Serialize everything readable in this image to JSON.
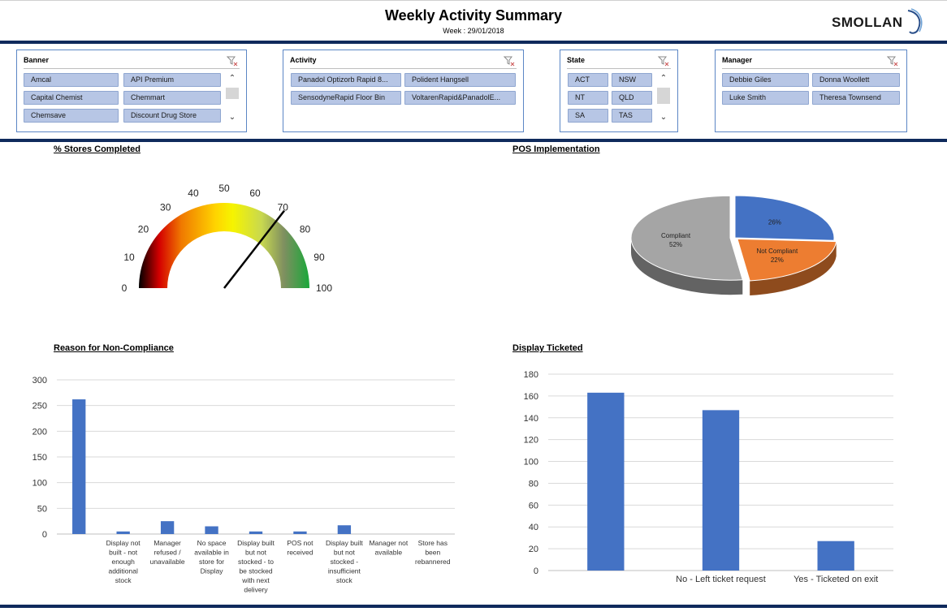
{
  "header": {
    "title": "Weekly Activity Summary",
    "subtitle": "Week : 29/01/2018",
    "logo_text": "SMOLLAN"
  },
  "slicers": {
    "banner": {
      "title": "Banner",
      "items": [
        "Amcal",
        "API Premium",
        "Capital Chemist",
        "Chemmart",
        "Chemsave",
        "Discount Drug Store"
      ]
    },
    "activity": {
      "title": "Activity",
      "items": [
        "Panadol Optizorb Rapid 8...",
        "Polident Hangsell",
        "SensodyneRapid Floor Bin",
        "VoltarenRapid&PanadolE..."
      ]
    },
    "state": {
      "title": "State",
      "items": [
        "ACT",
        "NSW",
        "NT",
        "QLD",
        "SA",
        "TAS"
      ]
    },
    "manager": {
      "title": "Manager",
      "items": [
        "Debbie Giles",
        "Donna Woollett",
        "Luke Smith",
        "Theresa Townsend"
      ]
    }
  },
  "sections": {
    "stores_completed": "% Stores Completed",
    "pos": "POS Implementation",
    "reason": "Reason for Non-Compliance",
    "ticketed": "Display Ticketed"
  },
  "chart_data": [
    {
      "type": "gauge",
      "title": "% Stores Completed",
      "ticks": [
        "0",
        "10",
        "20",
        "30",
        "40",
        "50",
        "60",
        "70",
        "80",
        "90",
        "100"
      ],
      "range": [
        0,
        100
      ],
      "value": 71
    },
    {
      "type": "pie",
      "title": "POS Implementation",
      "slices": [
        {
          "name": "",
          "label": "26%",
          "value": 26,
          "color": "#4472c4"
        },
        {
          "name": "Not Compliant",
          "label": "22%",
          "value": 22,
          "color": "#ed7d31"
        },
        {
          "name": "Compliant",
          "label": "52%",
          "value": 52,
          "color": "#a5a5a5"
        }
      ]
    },
    {
      "type": "bar",
      "title": "Reason for Non-Compliance",
      "categories": [
        "",
        "Display not built - not enough additional stock",
        "Manager refused / unavailable",
        "No space available in store for Display",
        "Display built but not stocked - to be stocked with next delivery",
        "POS not received",
        "Display built but not stocked - insufficient stock",
        "Manager not available",
        "Store has been rebannered"
      ],
      "values": [
        262,
        5,
        25,
        15,
        5,
        5,
        17,
        0,
        0
      ],
      "ylim": [
        0,
        300
      ],
      "yticks": [
        "0",
        "50",
        "100",
        "150",
        "200",
        "250",
        "300"
      ],
      "color": "#4472c4"
    },
    {
      "type": "bar",
      "title": "Display Ticketed",
      "categories": [
        "",
        "No - Left ticket request",
        "Yes - Ticketed on exit"
      ],
      "values": [
        163,
        147,
        27
      ],
      "ylim": [
        0,
        180
      ],
      "yticks": [
        "0",
        "20",
        "40",
        "60",
        "80",
        "100",
        "120",
        "140",
        "160",
        "180"
      ],
      "color": "#4472c4"
    }
  ]
}
